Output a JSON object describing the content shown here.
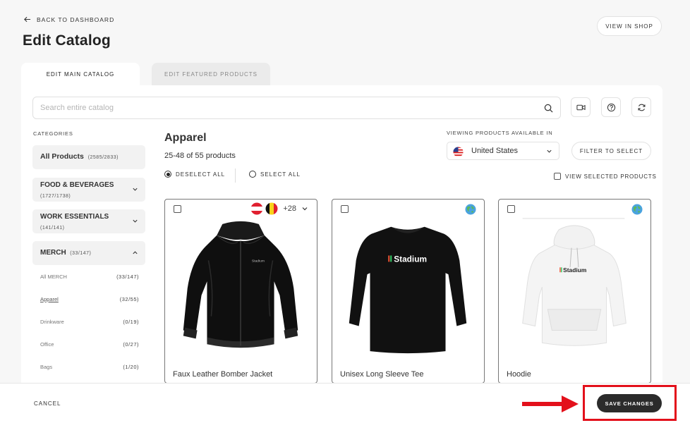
{
  "header": {
    "back_label": "BACK TO DASHBOARD",
    "title": "Edit Catalog",
    "view_in_shop": "VIEW IN SHOP"
  },
  "tabs": [
    {
      "label": "EDIT MAIN CATALOG",
      "active": true
    },
    {
      "label": "EDIT FEATURED PRODUCTS",
      "active": false
    }
  ],
  "search": {
    "placeholder": "Search entire catalog",
    "icons": [
      "search-icon",
      "video-icon",
      "help-icon",
      "refresh-icon"
    ]
  },
  "sidebar": {
    "heading": "CATEGORIES",
    "categories": [
      {
        "name": "All Products",
        "count": "(2585/2833)"
      },
      {
        "name": "FOOD & BEVERAGES",
        "count": "(1727/1738)",
        "expanded": false
      },
      {
        "name": "WORK ESSENTIALS",
        "count": "(141/141)",
        "expanded": false
      },
      {
        "name": "MERCH",
        "count": "(33/147)",
        "expanded": true
      }
    ],
    "subcategories": [
      {
        "name": "All MERCH",
        "count": "(33/147)"
      },
      {
        "name": "Apparel",
        "count": "(32/55)",
        "active": true
      },
      {
        "name": "Drinkware",
        "count": "(0/19)"
      },
      {
        "name": "Office",
        "count": "(0/27)"
      },
      {
        "name": "Bags",
        "count": "(1/20)"
      }
    ]
  },
  "main": {
    "section_title": "Apparel",
    "range": "25-48 of 55 products",
    "deselect_all": "DESELECT ALL",
    "select_all": "SELECT ALL",
    "viewing_label": "VIEWING PRODUCTS AVAILABLE IN",
    "country": "United States",
    "filter_button": "FILTER TO SELECT",
    "view_selected": "VIEW SELECTED PRODUCTS",
    "products": [
      {
        "name": "Faux Leather Bomber Jacket",
        "availability": "+28",
        "flags": [
          "austria",
          "belgium"
        ]
      },
      {
        "name": "Unisex Long Sleeve Tee",
        "brand": "Stadium",
        "availability": "globe"
      },
      {
        "name": "Hoodie",
        "brand": "Stadium",
        "availability": "globe"
      }
    ]
  },
  "footer": {
    "cancel": "CANCEL",
    "save": "SAVE CHANGES",
    "highlight_color": "#e3101b"
  }
}
